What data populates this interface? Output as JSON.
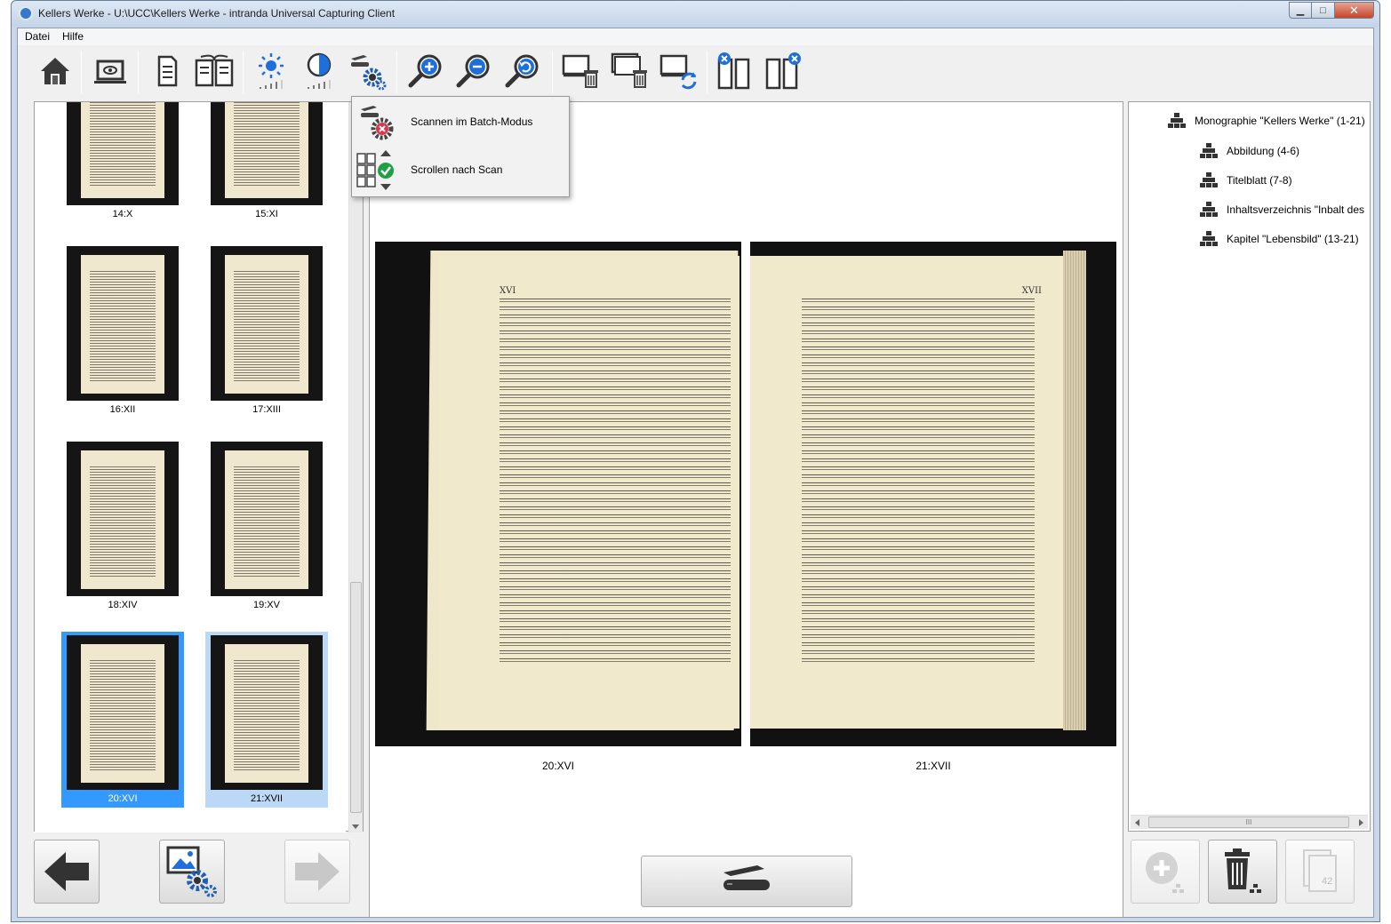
{
  "window": {
    "title": "Kellers Werke - U:\\UCC\\Kellers Werke - intranda Universal Capturing Client",
    "min_label": "▁",
    "max_label": "□",
    "close_label": "✕"
  },
  "menu": [
    {
      "label": "Datei"
    },
    {
      "label": "Hilfe"
    }
  ],
  "toolbar": {
    "buttons": [
      {
        "icon": "home-icon"
      },
      {
        "icon": "preview-icon"
      },
      {
        "icon": "single-page-icon"
      },
      {
        "icon": "double-page-icon"
      },
      {
        "icon": "brightness-icon"
      },
      {
        "icon": "contrast-icon"
      },
      {
        "icon": "scanner-settings-icon"
      },
      {
        "icon": "zoom-in-icon"
      },
      {
        "icon": "zoom-out-icon"
      },
      {
        "icon": "zoom-reset-icon"
      },
      {
        "icon": "delete-image-icon"
      },
      {
        "icon": "delete-all-icon"
      },
      {
        "icon": "rescan-icon"
      },
      {
        "icon": "close-left-page-icon"
      },
      {
        "icon": "close-right-page-icon"
      }
    ]
  },
  "popup": {
    "items": [
      {
        "label": "Scannen im Batch-Modus",
        "icon": "batch-scan-disabled-icon"
      },
      {
        "label": "Scrollen nach Scan",
        "icon": "scroll-after-scan-enabled-icon"
      }
    ]
  },
  "thumbnails": [
    {
      "label": "14:X"
    },
    {
      "label": "15:XI"
    },
    {
      "label": "16:XII"
    },
    {
      "label": "17:XIII"
    },
    {
      "label": "18:XIV"
    },
    {
      "label": "19:XV"
    },
    {
      "label": "20:XVI",
      "selected": true
    },
    {
      "label": "21:XVII",
      "selected": true
    }
  ],
  "viewer": {
    "left_label": "20:XVI",
    "right_label": "21:XVII",
    "left_header": "XVI",
    "right_header": "XVII"
  },
  "structure": {
    "root": "Monographie \"Kellers Werke\" (1-21)",
    "children": [
      {
        "label": "Abbildung (4-6)"
      },
      {
        "label": "Titelblatt (7-8)"
      },
      {
        "label": "Inhaltsverzeichnis \"Inbalt des"
      },
      {
        "label": "Kapitel \"Lebensbild\" (13-21)"
      }
    ],
    "hscroll_grip": "III"
  },
  "bottom_right": {
    "page_count_badge": "42"
  },
  "colors": {
    "selection": "#3399ff",
    "selection_secondary": "#bbd9f7",
    "accent_blue": "#1e6fd9"
  }
}
